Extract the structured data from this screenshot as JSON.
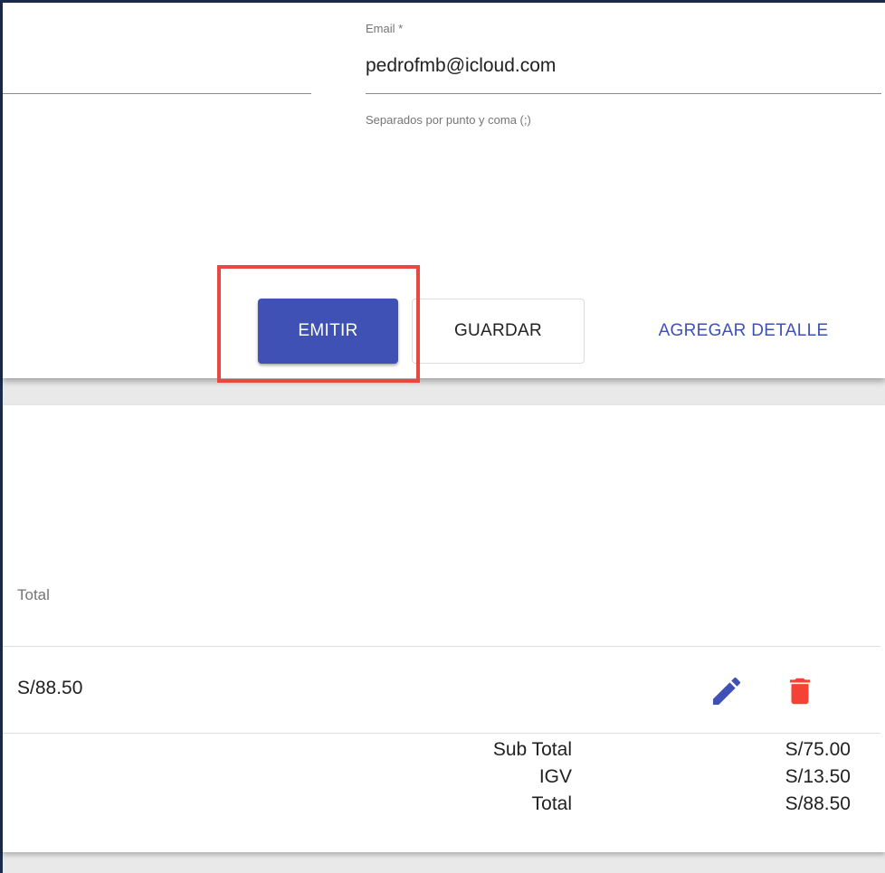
{
  "form": {
    "email": {
      "label": "Email *",
      "value": "pedrofmb@icloud.com",
      "hint": "Separados por punto y coma (;)"
    }
  },
  "actions": {
    "emitir_label": "EMITIR",
    "guardar_label": "GUARDAR",
    "agregar_label": "AGREGAR DETALLE"
  },
  "table": {
    "columns": [
      "Total"
    ],
    "rows": [
      {
        "total": "S/88.50"
      }
    ]
  },
  "summary": {
    "rows": [
      {
        "label": "Sub Total",
        "value": "S/75.00"
      },
      {
        "label": "IGV",
        "value": "S/13.50"
      },
      {
        "label": "Total",
        "value": "S/88.50"
      }
    ]
  },
  "colors": {
    "primary": "#3f51b5",
    "danger": "#f44336",
    "highlight": "#e8483f"
  },
  "icons": {
    "edit": "pencil-icon",
    "delete": "trash-icon"
  }
}
